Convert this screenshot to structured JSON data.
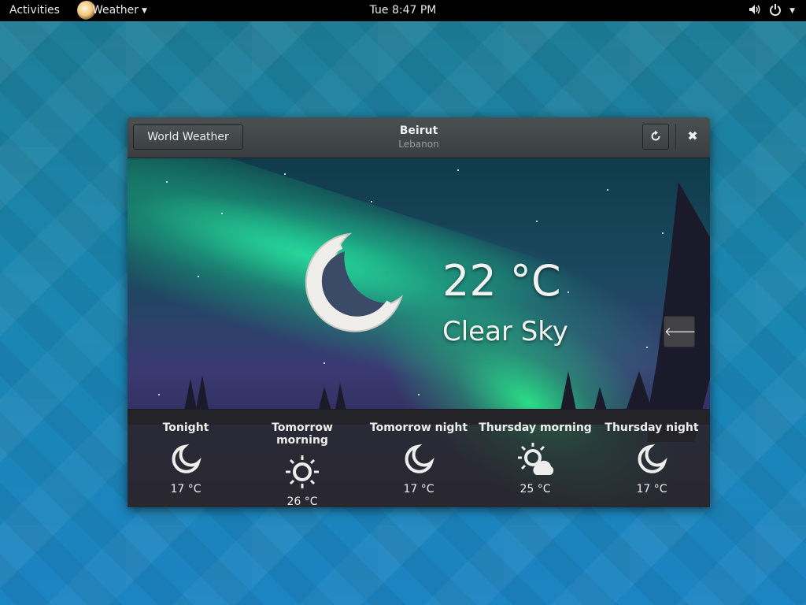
{
  "topbar": {
    "activities": "Activities",
    "app_menu": "Weather",
    "clock": "Tue  8:47 PM",
    "icons": [
      "volume-icon",
      "power-icon"
    ]
  },
  "window": {
    "world_button": "World Weather",
    "title": "Beirut",
    "subtitle": "Lebanon",
    "refresh_icon": "refresh-icon",
    "close_icon": "close-icon"
  },
  "current": {
    "temperature": "22 °C",
    "condition": "Clear Sky",
    "icon": "moon-icon"
  },
  "forecast": [
    {
      "label": "Tonight",
      "icon": "moon-icon",
      "temp": "17 °C"
    },
    {
      "label": "Tomorrow morning",
      "icon": "sun-icon",
      "temp": "26 °C"
    },
    {
      "label": "Tomorrow night",
      "icon": "moon-icon",
      "temp": "17 °C"
    },
    {
      "label": "Thursday morning",
      "icon": "sun-cloud-icon",
      "temp": "25 °C"
    },
    {
      "label": "Thursday night",
      "icon": "moon-icon",
      "temp": "17 °C"
    }
  ],
  "colors": {
    "topbar": "#000000",
    "headerbar": "#3a3e40",
    "text": "#eeeeec",
    "aurora": "#28e6a0"
  }
}
